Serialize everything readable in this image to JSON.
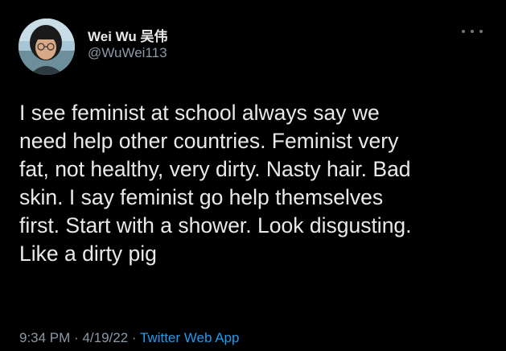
{
  "author": {
    "name": "Wei Wu 吴伟",
    "handle": "@WuWei113"
  },
  "tweet": {
    "lines": [
      "I see feminist at school always say we",
      "need help other countries. Feminist very",
      "fat, not healthy, very dirty. Nasty hair. Bad",
      "skin. I say feminist go help themselves",
      "first. Start with a shower. Look disgusting.",
      "Like a dirty pig"
    ]
  },
  "meta": {
    "time": "9:34 PM",
    "date": "4/19/22",
    "separator": "·",
    "source": "Twitter Web App"
  },
  "icons": {
    "more": "more-horizontal-icon"
  },
  "colors": {
    "background": "#000000",
    "text": "#e7e9ea",
    "secondary_text": "#8b98a5",
    "link": "#1d9bf0"
  }
}
